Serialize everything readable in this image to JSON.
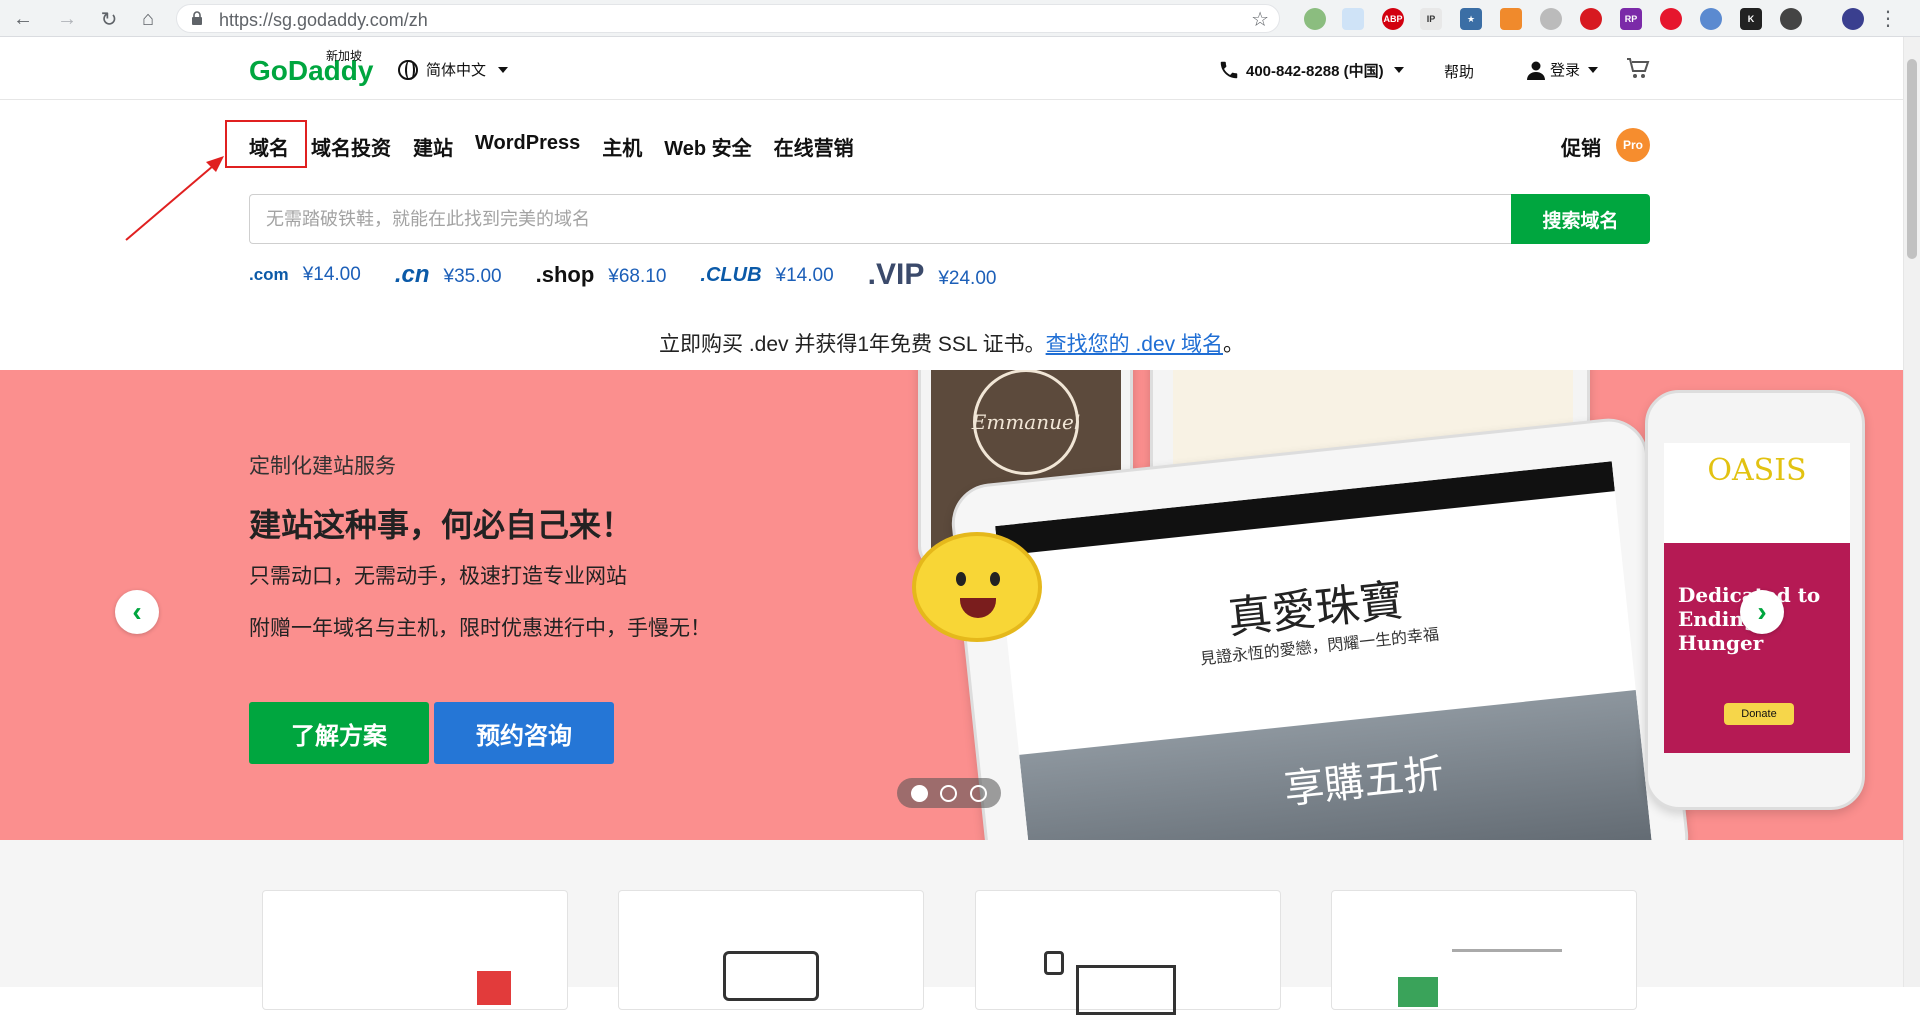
{
  "browser": {
    "url": "https://sg.godaddy.com/zh"
  },
  "header": {
    "logo_text": "GoDaddy",
    "logo_region": "新加坡",
    "language": "简体中文",
    "phone": "400-842-8288 (中国)",
    "help": "帮助",
    "login": "登录"
  },
  "nav": {
    "items": [
      "域名",
      "域名投资",
      "建站",
      "WordPress",
      "主机",
      "Web 安全",
      "在线营销"
    ],
    "promo": "促销",
    "pro_badge": "Pro"
  },
  "search": {
    "placeholder": "无需踏破铁鞋，就能在此找到完美的域名",
    "button": "搜索域名"
  },
  "tlds": [
    {
      "name": ".com",
      "price": "¥14.00"
    },
    {
      "name": ".cn",
      "price": "¥35.00"
    },
    {
      "name": ".shop",
      "price": "¥68.10"
    },
    {
      "name": ".CLUB",
      "price": "¥14.00"
    },
    {
      "name": ".VIP",
      "price": "¥24.00"
    }
  ],
  "dev_promo": {
    "text": "立即购买 .dev 并获得1年免费 SSL 证书。",
    "link": "查找您的 .dev 域名",
    "suffix": "。"
  },
  "hero": {
    "subtitle": "定制化建站服务",
    "title": "建站这种事，何必自己来！",
    "line1": "只需动口，无需动手，极速打造专业网站",
    "line2": "附赠一年域名与主机，限时优惠进行中，手慢无！",
    "btn_primary": "了解方案",
    "btn_secondary": "预约咨询",
    "tablet_heading": "真愛珠寶",
    "tablet_sub": "見證永恆的愛戀，閃耀一生的幸福",
    "tablet_banner": "享購五折",
    "phone_brand": "OASIS",
    "phone_headline": "Dedicated to Ending Hunger",
    "phone_button": "Donate",
    "coffee_brand": "Emmanuel"
  },
  "colors": {
    "brand_green": "#00a63f",
    "link_blue": "#1f6ed4",
    "hero_bg": "#fb8f8e",
    "highlight_red": "#e02020",
    "pro_orange": "#f68d2e"
  }
}
